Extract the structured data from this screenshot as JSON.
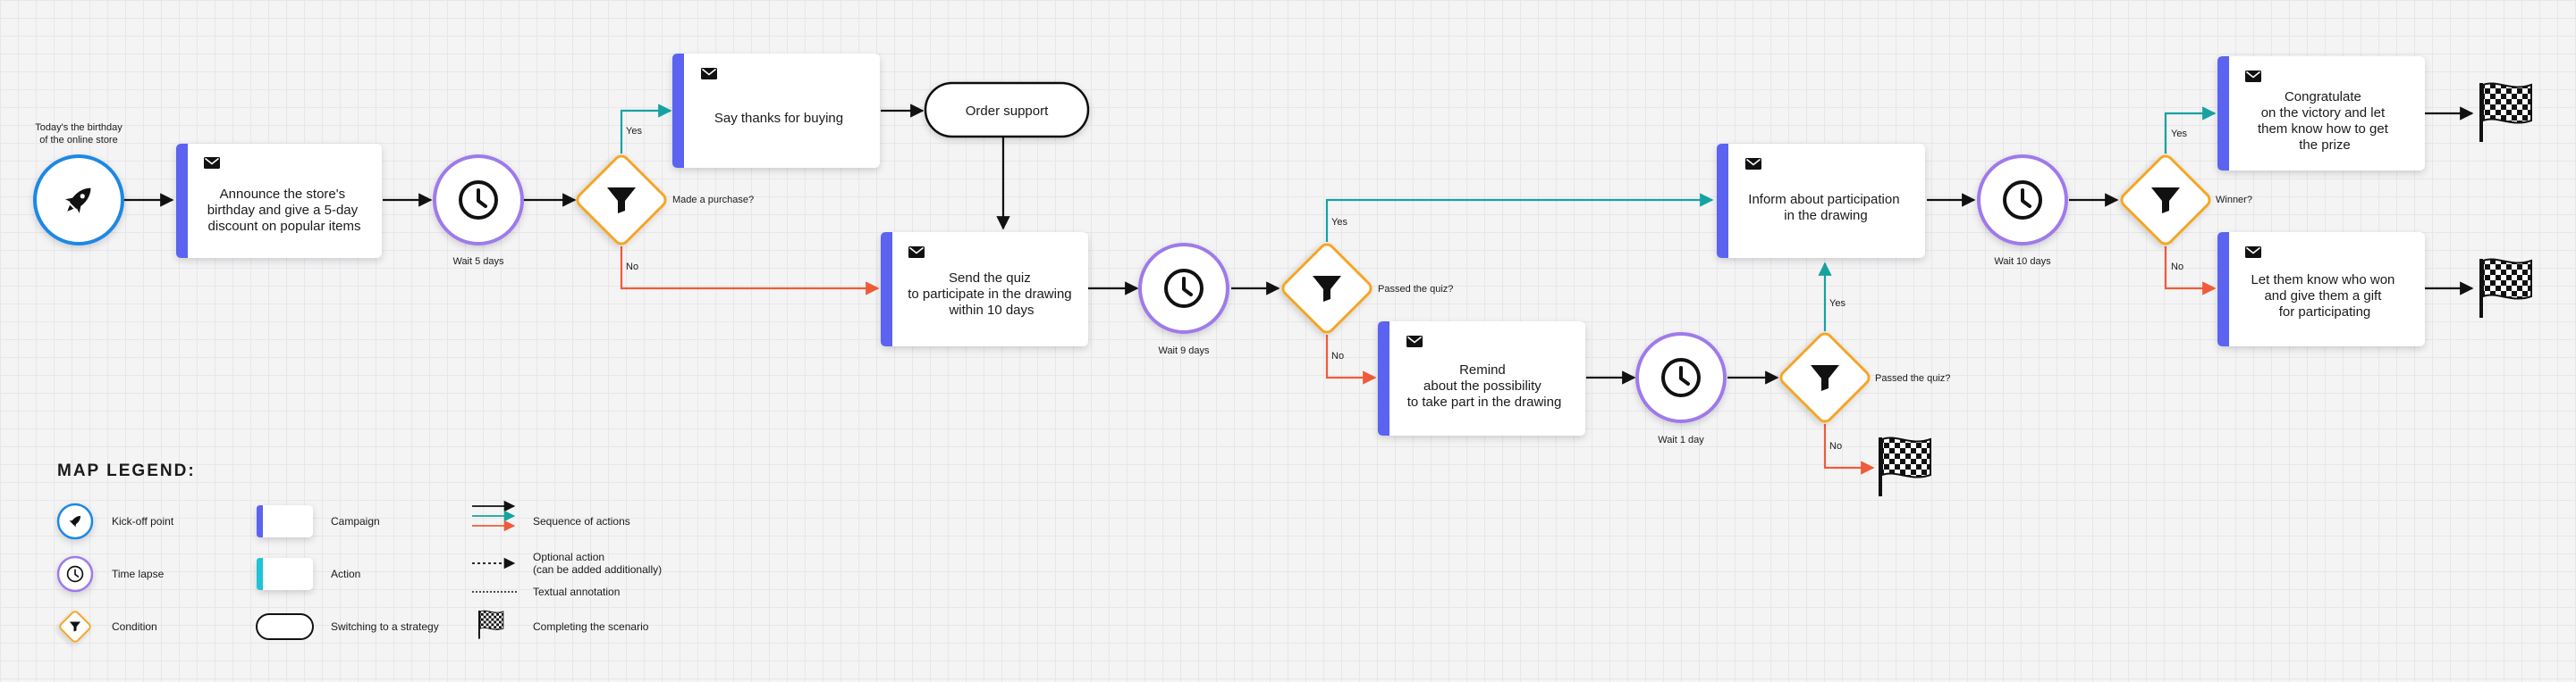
{
  "start": {
    "caption_line1": "Today's the birthday",
    "caption_line2": "of the online store"
  },
  "cards": {
    "announce": [
      "Announce the store's",
      "birthday and give a 5-day",
      "discount on popular items"
    ],
    "thanks": [
      "Say thanks for buying"
    ],
    "quiz": [
      "Send the quiz",
      "to participate in the drawing",
      "within 10 days"
    ],
    "remind": [
      "Remind",
      "about the possibility",
      "to take part in the drawing"
    ],
    "inform": [
      "Inform about participation",
      "in the drawing"
    ],
    "congrats": [
      "Congratulate",
      "on the victory and let",
      "them know how to get",
      "the prize"
    ],
    "whowon": [
      "Let them know who won",
      "and give them a gift",
      "for participating"
    ]
  },
  "strategy": {
    "order_support": "Order support"
  },
  "timers": {
    "w5": "Wait 5 days",
    "w9": "Wait 9 days",
    "w1": "Wait 1 day",
    "w10": "Wait 10 days"
  },
  "conditions": {
    "c1": "Made a purchase?",
    "c2": "Passed the quiz?",
    "c3": "Passed the quiz?",
    "c4": "Winner?"
  },
  "branch_labels": {
    "yes": "Yes",
    "no": "No"
  },
  "legend": {
    "title": "MAP LEGEND:",
    "kickoff": "Kick-off point",
    "timelapse": "Time lapse",
    "condition": "Condition",
    "campaign": "Campaign",
    "action": "Action",
    "switching": "Switching to a strategy",
    "sequence": "Sequence of actions",
    "optional_line1": "Optional action",
    "optional_line2": "(can be added additionally)",
    "textual": "Textual annotation",
    "completing": "Completing the scenario"
  },
  "colors": {
    "campaign_accent": "#5b63f0",
    "action_accent": "#1fc3d6",
    "kickoff": "#1e88e5",
    "timer": "#9f7aea",
    "condition": "#f5a623",
    "yes_arrow": "#17a2a2",
    "no_arrow": "#ef5b3a",
    "sequence_arrow": "#111111"
  }
}
